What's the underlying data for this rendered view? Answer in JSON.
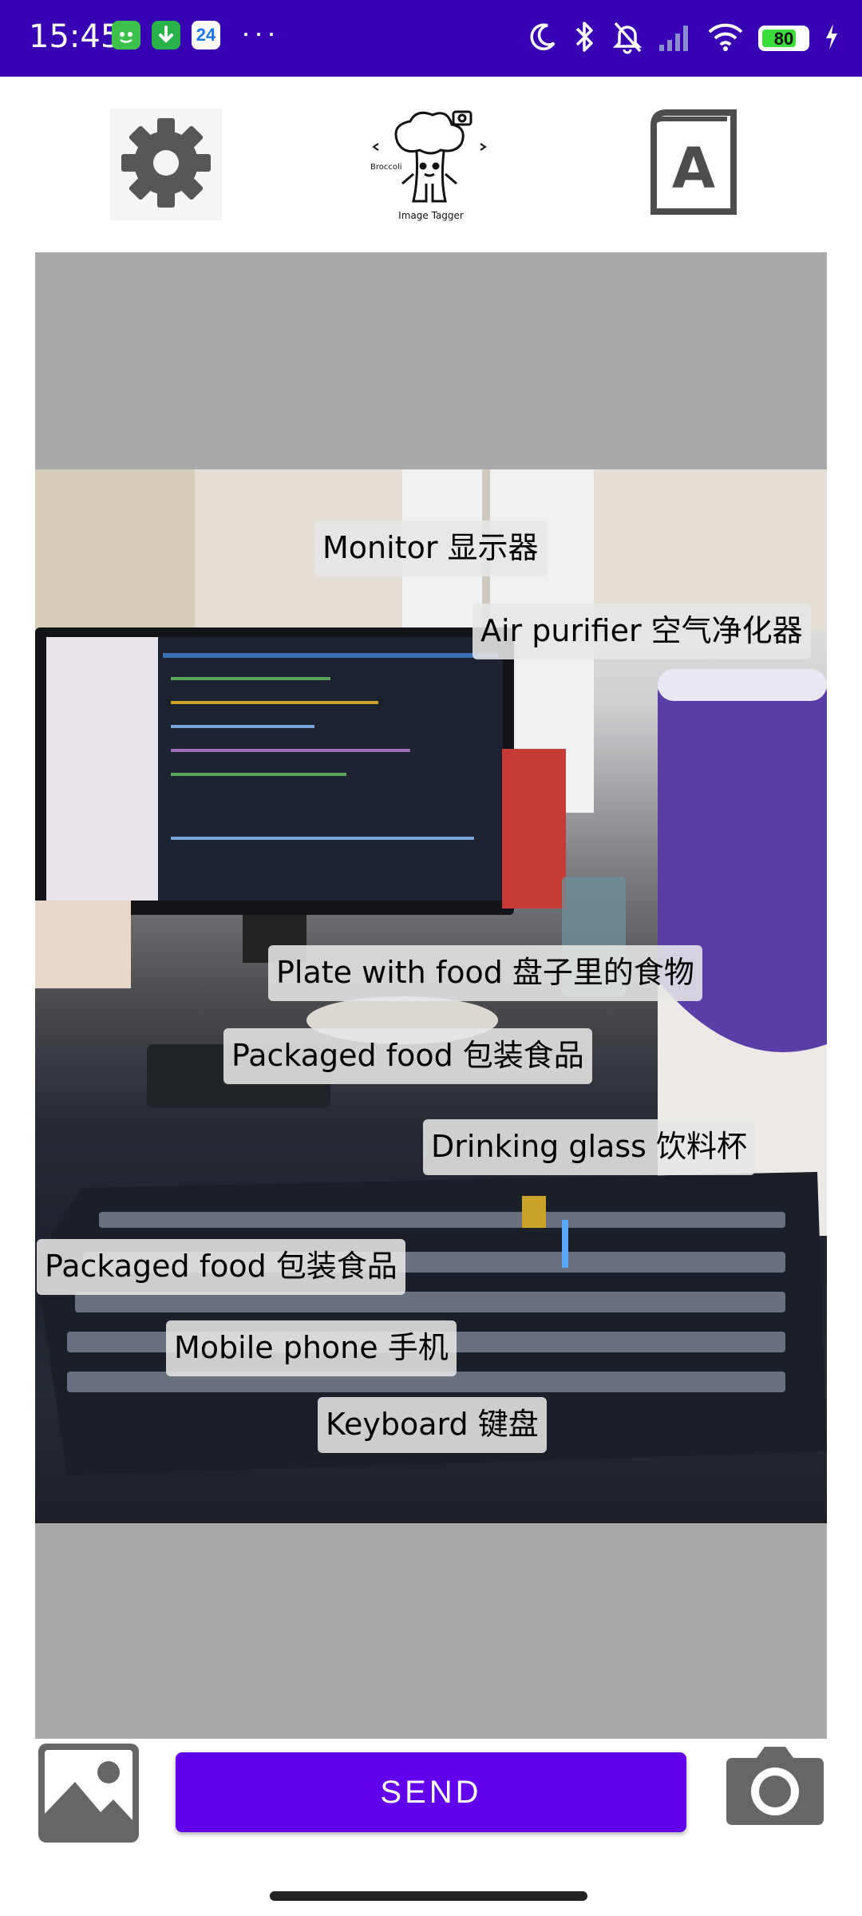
{
  "status_bar": {
    "time": "15:45",
    "date_badge": "24",
    "overflow": "···",
    "battery_level": 80,
    "battery_text": "80",
    "icons": [
      "moon-icon",
      "bluetooth-icon",
      "bell-off-icon",
      "signal-icon",
      "wifi-icon",
      "battery-icon",
      "charging-icon"
    ]
  },
  "toolbar": {
    "settings_icon": "gear-icon",
    "logo_brand": "Broccoli",
    "logo_caption": "Image Tagger",
    "dictionary_letter": "A"
  },
  "tags": [
    {
      "label": "Monitor 显示器"
    },
    {
      "label": "Air purifier 空气净化器"
    },
    {
      "label": "Plate with food 盘子里的食物"
    },
    {
      "label": "Packaged food 包装食品"
    },
    {
      "label": "Drinking glass 饮料杯"
    },
    {
      "label": "Packaged food 包装食品"
    },
    {
      "label": "Mobile phone 手机"
    },
    {
      "label": "Keyboard 键盘"
    }
  ],
  "bottom": {
    "gallery_icon": "image-icon",
    "send_label": "SEND",
    "camera_icon": "camera-icon"
  },
  "colors": {
    "status_bar": "#3700b3",
    "accent": "#6200ee",
    "preview_background": "#a9a9a9"
  }
}
